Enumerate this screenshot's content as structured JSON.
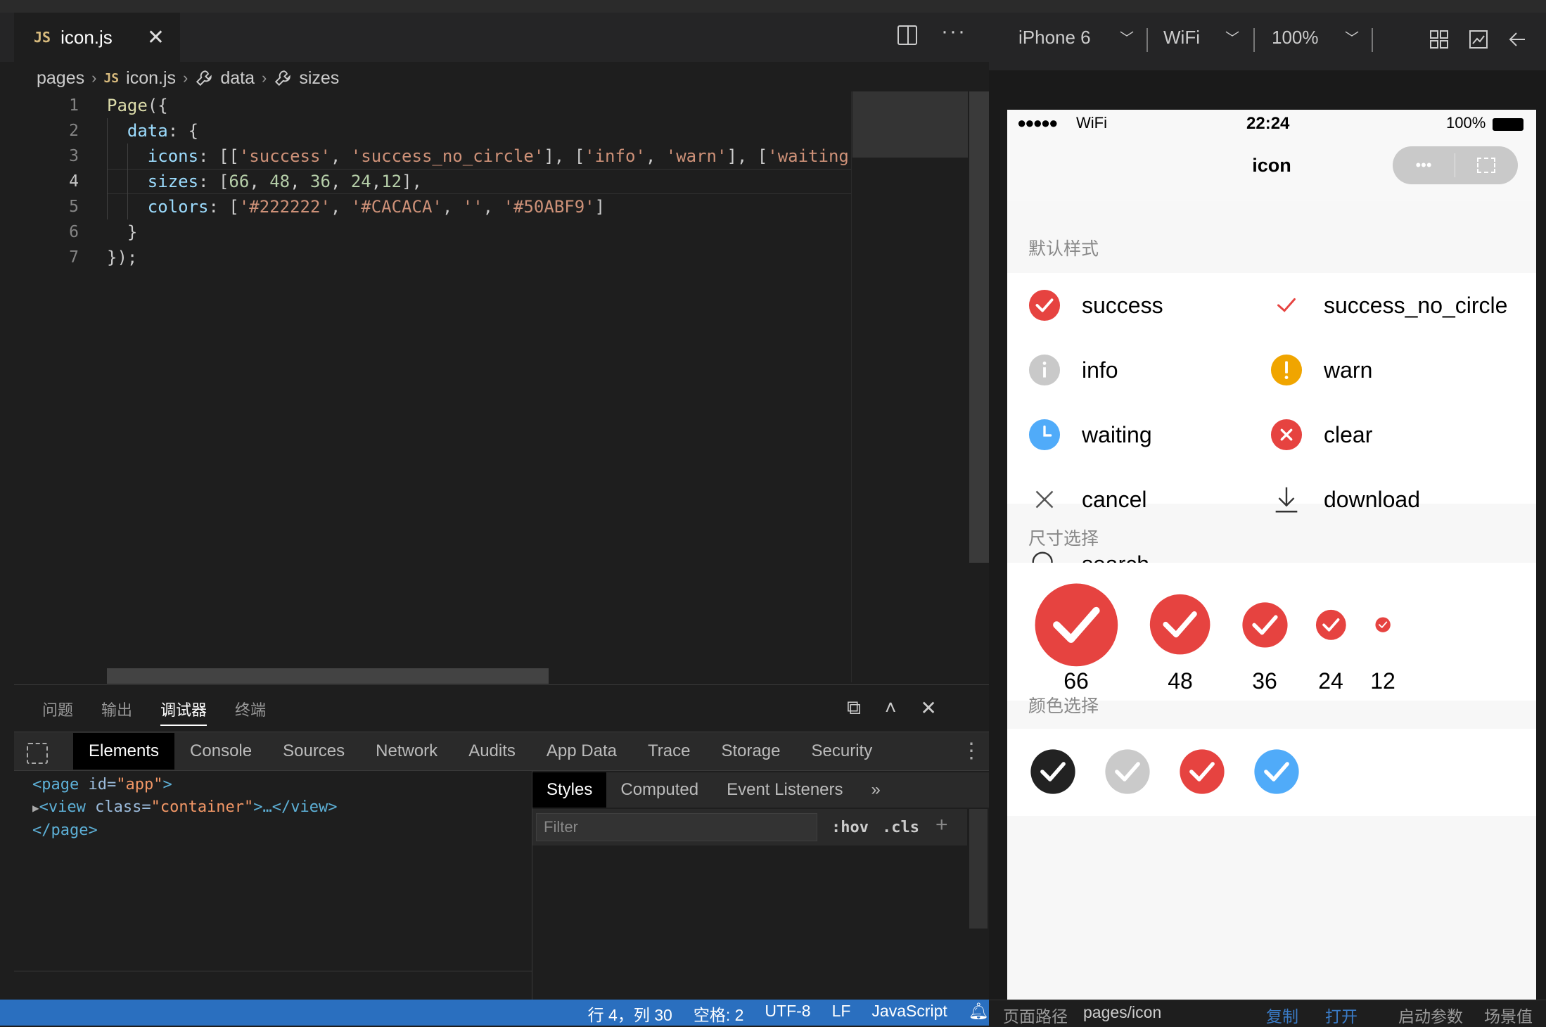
{
  "editor": {
    "tab_title": "icon.js",
    "js_badge": "JS",
    "breadcrumb": [
      "pages",
      "icon.js",
      "data",
      "sizes"
    ],
    "line_numbers": [
      "1",
      "2",
      "3",
      "4",
      "5",
      "6",
      "7"
    ],
    "code_lines": [
      {
        "indent": "",
        "parts": [
          {
            "c": "kw",
            "t": "Page"
          },
          {
            "c": "txt",
            "t": "({"
          }
        ]
      },
      {
        "indent": "  ",
        "parts": [
          {
            "c": "prop",
            "t": "data"
          },
          {
            "c": "txt",
            "t": ": {"
          }
        ]
      },
      {
        "indent": "    ",
        "parts": [
          {
            "c": "prop",
            "t": "icons"
          },
          {
            "c": "txt",
            "t": ": [["
          },
          {
            "c": "str",
            "t": "'success'"
          },
          {
            "c": "txt",
            "t": ", "
          },
          {
            "c": "str",
            "t": "'success_no_circle'"
          },
          {
            "c": "txt",
            "t": "], ["
          },
          {
            "c": "str",
            "t": "'info'"
          },
          {
            "c": "txt",
            "t": ", "
          },
          {
            "c": "str",
            "t": "'warn'"
          },
          {
            "c": "txt",
            "t": "], ["
          },
          {
            "c": "str",
            "t": "'waiting'"
          }
        ]
      },
      {
        "indent": "    ",
        "parts": [
          {
            "c": "prop",
            "t": "sizes"
          },
          {
            "c": "txt",
            "t": ": ["
          },
          {
            "c": "num",
            "t": "66"
          },
          {
            "c": "txt",
            "t": ", "
          },
          {
            "c": "num",
            "t": "48"
          },
          {
            "c": "txt",
            "t": ", "
          },
          {
            "c": "num",
            "t": "36"
          },
          {
            "c": "txt",
            "t": ", "
          },
          {
            "c": "num",
            "t": "24"
          },
          {
            "c": "txt",
            "t": ","
          },
          {
            "c": "num",
            "t": "12"
          },
          {
            "c": "txt",
            "t": "],"
          }
        ]
      },
      {
        "indent": "    ",
        "parts": [
          {
            "c": "prop",
            "t": "colors"
          },
          {
            "c": "txt",
            "t": ": ["
          },
          {
            "c": "str",
            "t": "'#222222'"
          },
          {
            "c": "txt",
            "t": ", "
          },
          {
            "c": "str",
            "t": "'#CACACA'"
          },
          {
            "c": "txt",
            "t": ", "
          },
          {
            "c": "str",
            "t": "''"
          },
          {
            "c": "txt",
            "t": ", "
          },
          {
            "c": "str",
            "t": "'#50ABF9'"
          },
          {
            "c": "txt",
            "t": "]"
          }
        ]
      },
      {
        "indent": "  ",
        "parts": [
          {
            "c": "txt",
            "t": "}"
          }
        ]
      },
      {
        "indent": "",
        "parts": [
          {
            "c": "txt",
            "t": "});"
          }
        ]
      }
    ],
    "active_line": 4
  },
  "panel": {
    "tabs": [
      "问题",
      "输出",
      "调试器",
      "终端"
    ],
    "active_tab": "调试器"
  },
  "devtools": {
    "tabs": [
      "Elements",
      "Console",
      "Sources",
      "Network",
      "Audits",
      "App Data",
      "Trace",
      "Storage",
      "Security"
    ],
    "active_tab": "Elements",
    "dom": {
      "line1_tag_open": "<page",
      "line1_attr": " id=",
      "line1_val": "\"app\"",
      "line1_close": ">",
      "line2_tag": "<view",
      "line2_attr": " class=",
      "line2_val": "\"container\"",
      "line2_rest": ">…</view>",
      "line3": "</page>"
    },
    "styles_tabs": [
      "Styles",
      "Computed",
      "Event Listeners"
    ],
    "styles_more": "»",
    "filter_placeholder": "Filter",
    "hov": ":hov",
    "cls": ".cls",
    "plus": "+"
  },
  "status_bar": {
    "position": "行 4，列 30",
    "spaces": "空格: 2",
    "encoding": "UTF-8",
    "eol": "LF",
    "language": "JavaScript"
  },
  "simulator": {
    "device": "iPhone 6",
    "network": "WiFi",
    "zoom": "100%",
    "phone_status": {
      "signal": "●●●●●",
      "wifi": "WiFi",
      "time": "22:24",
      "battery": "100%"
    },
    "nav_title": "icon",
    "capsule_dots": "•••",
    "section_default": "默认样式",
    "icons": [
      {
        "name": "success",
        "type": "success",
        "color": "#E64340"
      },
      {
        "name": "success_no_circle",
        "type": "success_no_circle",
        "color": "#E64340"
      },
      {
        "name": "info",
        "type": "info",
        "color": "#C9C9C9"
      },
      {
        "name": "warn",
        "type": "warn",
        "color": "#F0A500"
      },
      {
        "name": "waiting",
        "type": "waiting",
        "color": "#50ABF9"
      },
      {
        "name": "clear",
        "type": "clear",
        "color": "#E64340"
      },
      {
        "name": "cancel",
        "type": "cancel",
        "color": "#555555"
      },
      {
        "name": "download",
        "type": "download",
        "color": "#333333"
      },
      {
        "name": "search",
        "type": "search",
        "color": "#333333"
      }
    ],
    "section_sizes": "尺寸选择",
    "sizes": [
      66,
      48,
      36,
      24,
      12
    ],
    "section_colors": "颜色选择",
    "colors": [
      "#222222",
      "#CACACA",
      "#E64340",
      "#50ABF9"
    ],
    "bottom": {
      "path_label": "页面路径",
      "path_value": "pages/icon",
      "copy": "复制",
      "open": "打开",
      "launch_params": "启动参数",
      "scene": "场景值"
    }
  }
}
